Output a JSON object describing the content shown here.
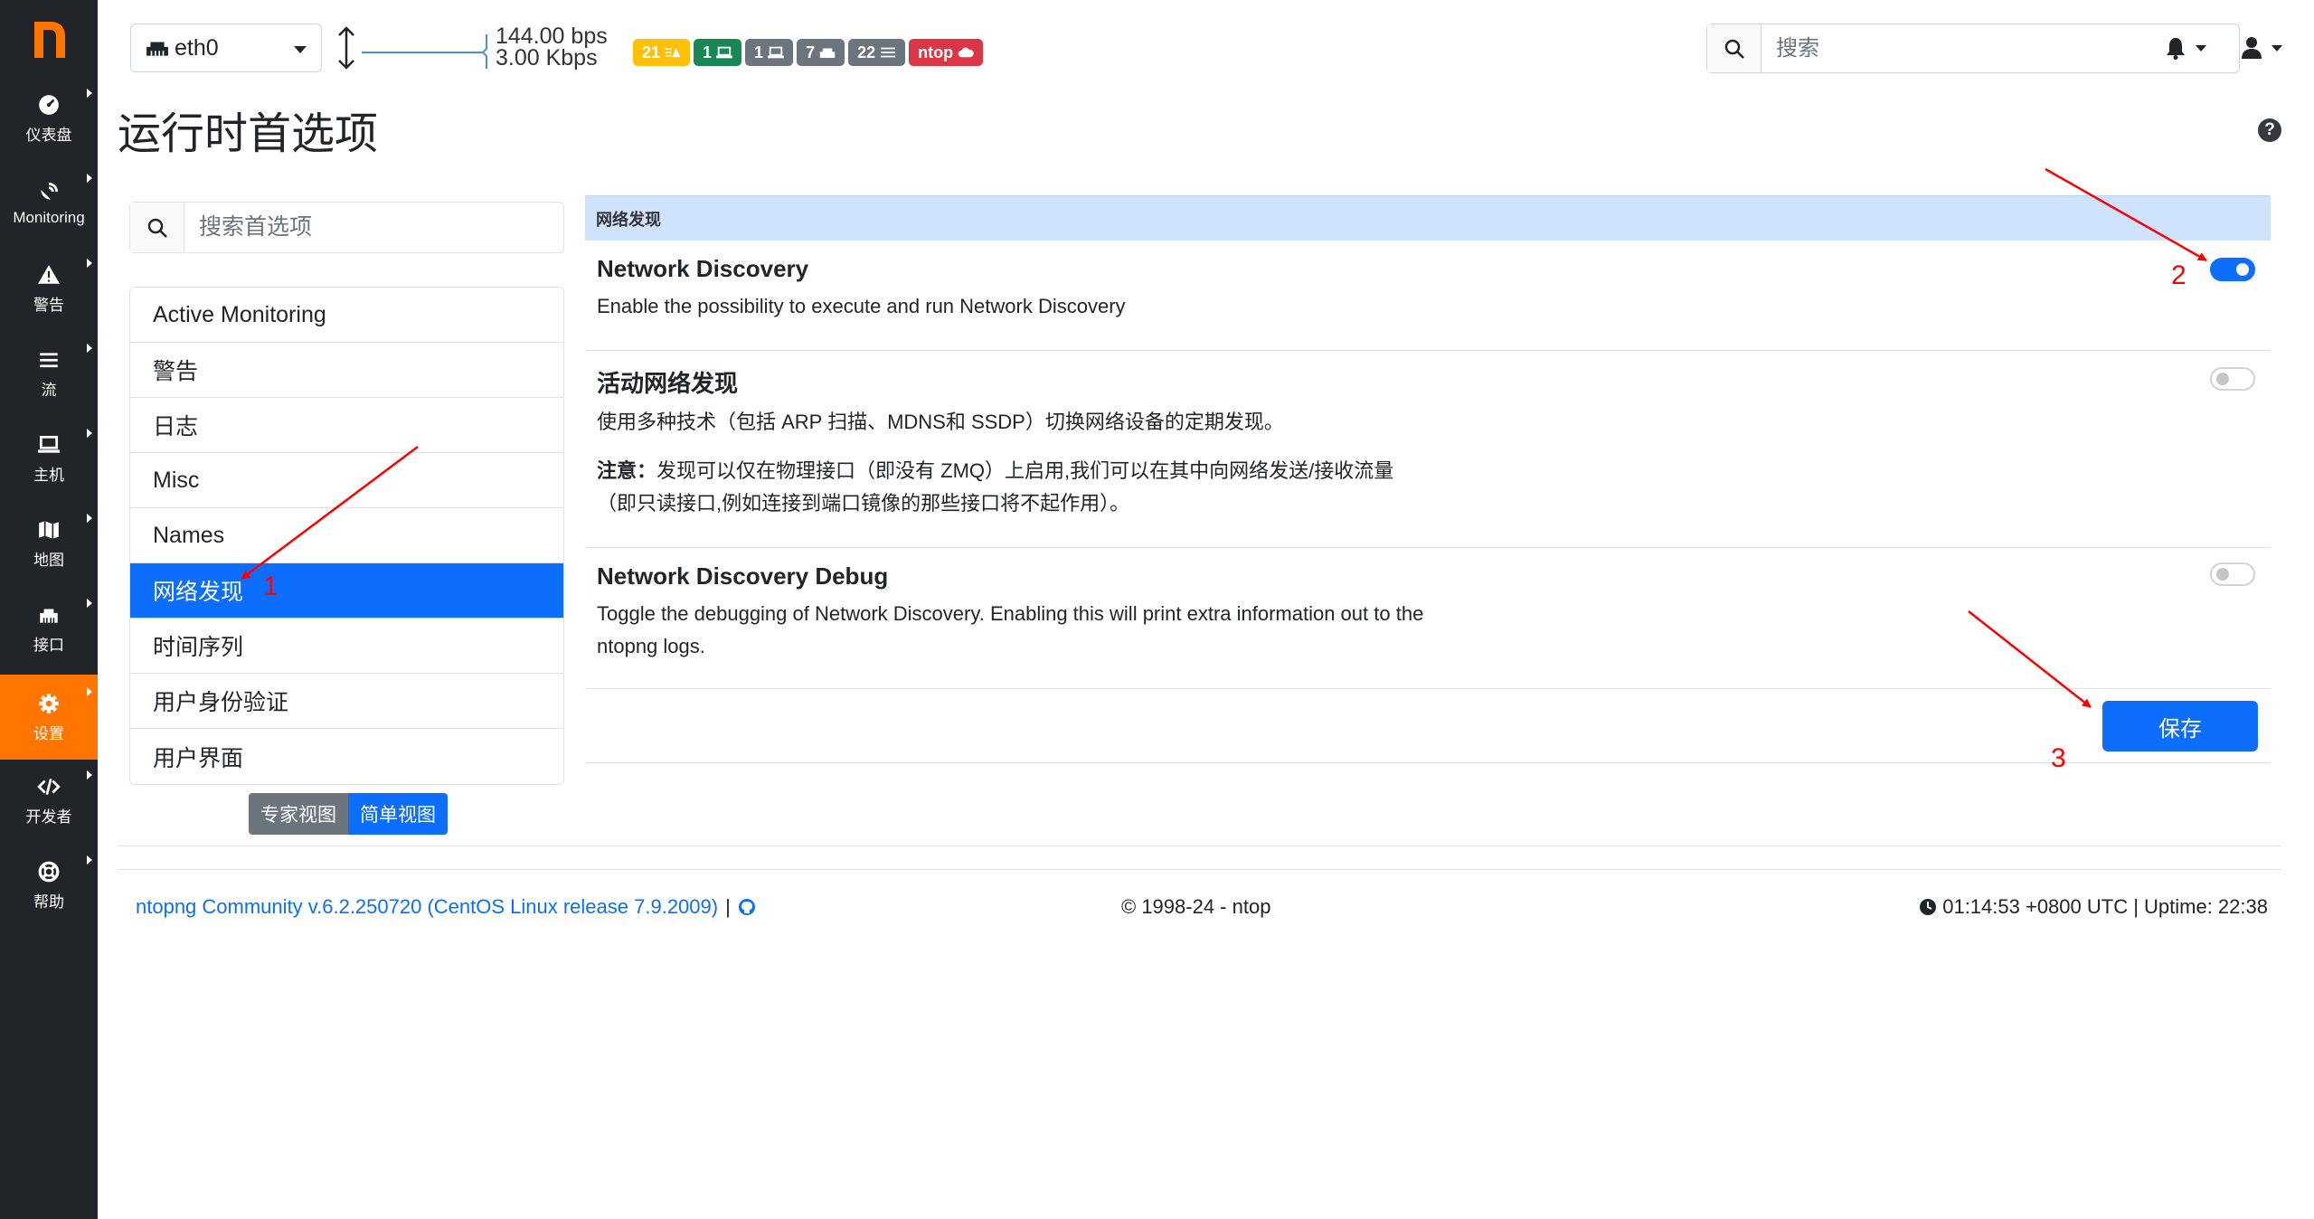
{
  "sidebar": {
    "logo": "ntopng-logo",
    "items": [
      {
        "label": "仪表盘",
        "icon": "dashboard-icon"
      },
      {
        "label": "Monitoring",
        "icon": "satellite-dish-icon"
      },
      {
        "label": "警告",
        "icon": "warning-icon"
      },
      {
        "label": "流",
        "icon": "stream-icon"
      },
      {
        "label": "主机",
        "icon": "laptop-icon"
      },
      {
        "label": "地图",
        "icon": "map-icon"
      },
      {
        "label": "接口",
        "icon": "ethernet-icon"
      },
      {
        "label": "设置",
        "icon": "gear-icon",
        "active": true
      },
      {
        "label": "开发者",
        "icon": "code-icon"
      },
      {
        "label": "帮助",
        "icon": "life-ring-icon"
      }
    ]
  },
  "topbar": {
    "interface": "eth0",
    "rate_up": "144.00 bps",
    "rate_down": "3.00 Kbps",
    "badges": [
      {
        "text": "21",
        "icon": "warning-list-icon",
        "color": "#ffc107"
      },
      {
        "text": "1",
        "icon": "laptop-icon",
        "color": "#198754"
      },
      {
        "text": "1",
        "icon": "laptop-icon",
        "color": "#6c757d"
      },
      {
        "text": "7",
        "icon": "ethernet-icon",
        "color": "#6c757d"
      },
      {
        "text": "22",
        "icon": "list-icon",
        "color": "#6c757d"
      },
      {
        "text": "ntop",
        "icon": "cloud-icon",
        "color": "#dc3545"
      }
    ],
    "search_placeholder": "搜索"
  },
  "page": {
    "title": "运行时首选项",
    "help": "?"
  },
  "prefs": {
    "search_placeholder": "搜索首选项",
    "items": [
      {
        "label": "Active Monitoring"
      },
      {
        "label": "警告"
      },
      {
        "label": "日志"
      },
      {
        "label": "Misc"
      },
      {
        "label": "Names"
      },
      {
        "label": "网络发现",
        "active": true
      },
      {
        "label": "时间序列"
      },
      {
        "label": "用户身份验证"
      },
      {
        "label": "用户界面"
      }
    ],
    "view_expert": "专家视图",
    "view_simple": "简单视图"
  },
  "panel": {
    "header": "网络发现",
    "settings": [
      {
        "title": "Network Discovery",
        "desc": "Enable the possibility to execute and run Network Discovery",
        "enabled": true
      },
      {
        "title": "活动网络发现",
        "desc": "使用多种技术（包括 ARP 扫描、MDNS和 SSDP）切换网络设备的定期发现。",
        "note_label": "注意：",
        "note": "发现可以仅在物理接口（即没有 ZMQ）上启用,我们可以在其中向网络发送/接收流量（即只读接口,例如连接到端口镜像的那些接口将不起作用）。",
        "enabled": false
      },
      {
        "title": "Network Discovery Debug",
        "desc": "Toggle the debugging of Network Discovery. Enabling this will print extra information out to the ntopng logs.",
        "enabled": false
      }
    ],
    "save_label": "保存"
  },
  "footer": {
    "version": "ntopng Community v.6.2.250720 (CentOS Linux release 7.9.2009)",
    "separator": "|",
    "copyright": "© 1998-24 - ntop",
    "time": "01:14:53 +0800 UTC | Uptime: 22:38"
  },
  "annotations": [
    "1",
    "2",
    "3"
  ],
  "colors": {
    "accent": "#0d6efd",
    "sidebar_bg": "#212529",
    "active_sidebar": "#ff7500",
    "annotation": "#ff0000"
  }
}
